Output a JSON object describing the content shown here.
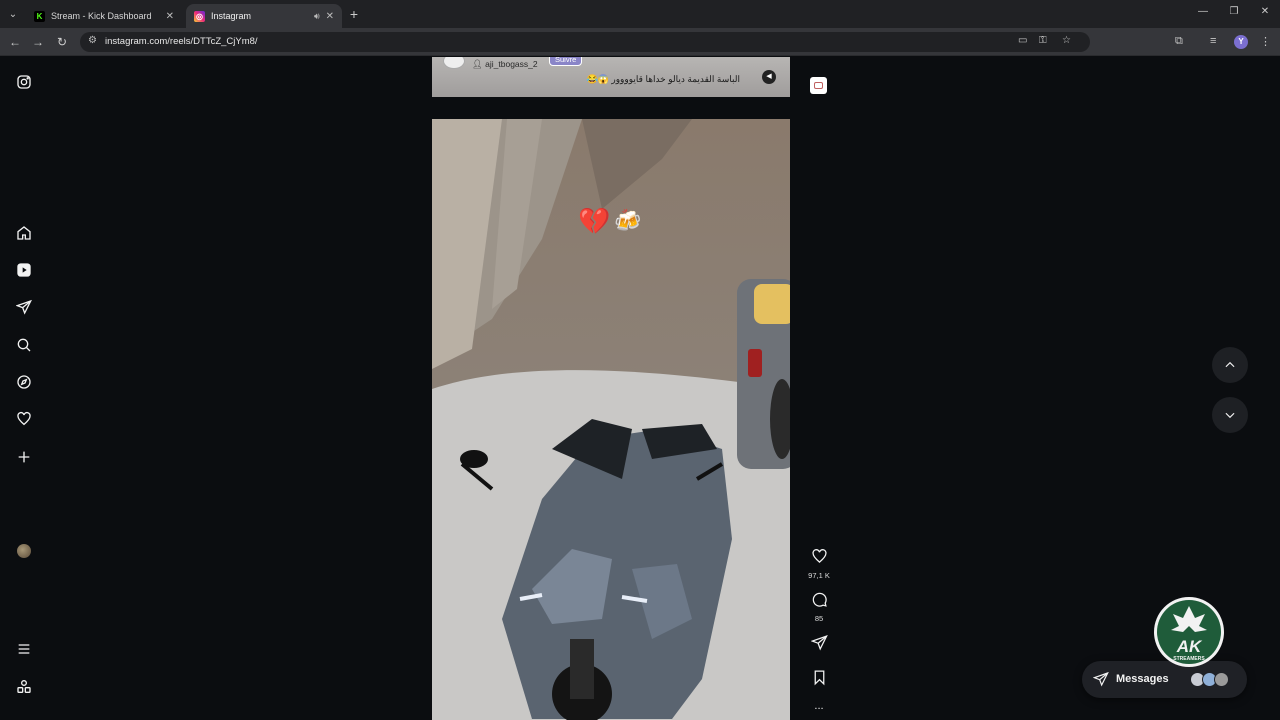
{
  "browser": {
    "tabs": [
      {
        "title": "Stream - Kick Dashboard",
        "favicon": "kick-icon",
        "active": false
      },
      {
        "title": "Instagram",
        "favicon": "instagram-icon",
        "active": true
      }
    ],
    "address": "instagram.com/reels/DTTcZ_CjYm8/",
    "profile_initial": "Y"
  },
  "reel_prev": {
    "username": "aji_tbogass_2",
    "follow_label": "Suivre",
    "caption": "الباسة القديمة ديالو خداها قايوووور 😱😂"
  },
  "reel": {
    "emoji_1": "💔",
    "emoji_2": "🍻"
  },
  "actions": {
    "likes": "97,1 K",
    "comments": "85",
    "more": "..."
  },
  "messages": {
    "label": "Messages"
  },
  "overlay_logo": {
    "big": "AK",
    "small": "STREAMERS"
  },
  "colors": {
    "background": "#0b0d10",
    "accent_logo": "#1f5c3a"
  }
}
